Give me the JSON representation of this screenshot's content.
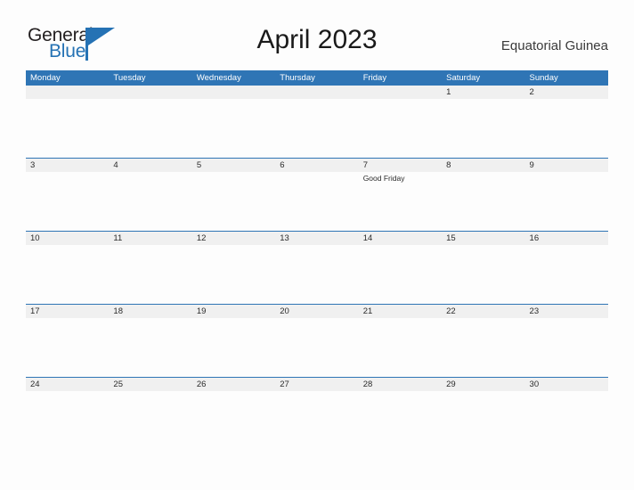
{
  "brand": {
    "name_part1": "General",
    "name_part2": "Blue",
    "triangle_color": "#2572b4"
  },
  "header": {
    "title": "April 2023",
    "country": "Equatorial Guinea"
  },
  "theme": {
    "header_blue": "#2f75b5",
    "band_gray": "#f0f0f0",
    "page_background": "#fdfdfd",
    "text_dark": "#2a2a2a"
  },
  "calendar": {
    "weekdays": [
      "Monday",
      "Tuesday",
      "Wednesday",
      "Thursday",
      "Friday",
      "Saturday",
      "Sunday"
    ],
    "weeks": [
      {
        "days": [
          {
            "number": "",
            "events": []
          },
          {
            "number": "",
            "events": []
          },
          {
            "number": "",
            "events": []
          },
          {
            "number": "",
            "events": []
          },
          {
            "number": "",
            "events": []
          },
          {
            "number": "1",
            "events": []
          },
          {
            "number": "2",
            "events": []
          }
        ]
      },
      {
        "days": [
          {
            "number": "3",
            "events": []
          },
          {
            "number": "4",
            "events": []
          },
          {
            "number": "5",
            "events": []
          },
          {
            "number": "6",
            "events": []
          },
          {
            "number": "7",
            "events": [
              "Good Friday"
            ]
          },
          {
            "number": "8",
            "events": []
          },
          {
            "number": "9",
            "events": []
          }
        ]
      },
      {
        "days": [
          {
            "number": "10",
            "events": []
          },
          {
            "number": "11",
            "events": []
          },
          {
            "number": "12",
            "events": []
          },
          {
            "number": "13",
            "events": []
          },
          {
            "number": "14",
            "events": []
          },
          {
            "number": "15",
            "events": []
          },
          {
            "number": "16",
            "events": []
          }
        ]
      },
      {
        "days": [
          {
            "number": "17",
            "events": []
          },
          {
            "number": "18",
            "events": []
          },
          {
            "number": "19",
            "events": []
          },
          {
            "number": "20",
            "events": []
          },
          {
            "number": "21",
            "events": []
          },
          {
            "number": "22",
            "events": []
          },
          {
            "number": "23",
            "events": []
          }
        ]
      },
      {
        "days": [
          {
            "number": "24",
            "events": []
          },
          {
            "number": "25",
            "events": []
          },
          {
            "number": "26",
            "events": []
          },
          {
            "number": "27",
            "events": []
          },
          {
            "number": "28",
            "events": []
          },
          {
            "number": "29",
            "events": []
          },
          {
            "number": "30",
            "events": []
          }
        ]
      }
    ]
  }
}
